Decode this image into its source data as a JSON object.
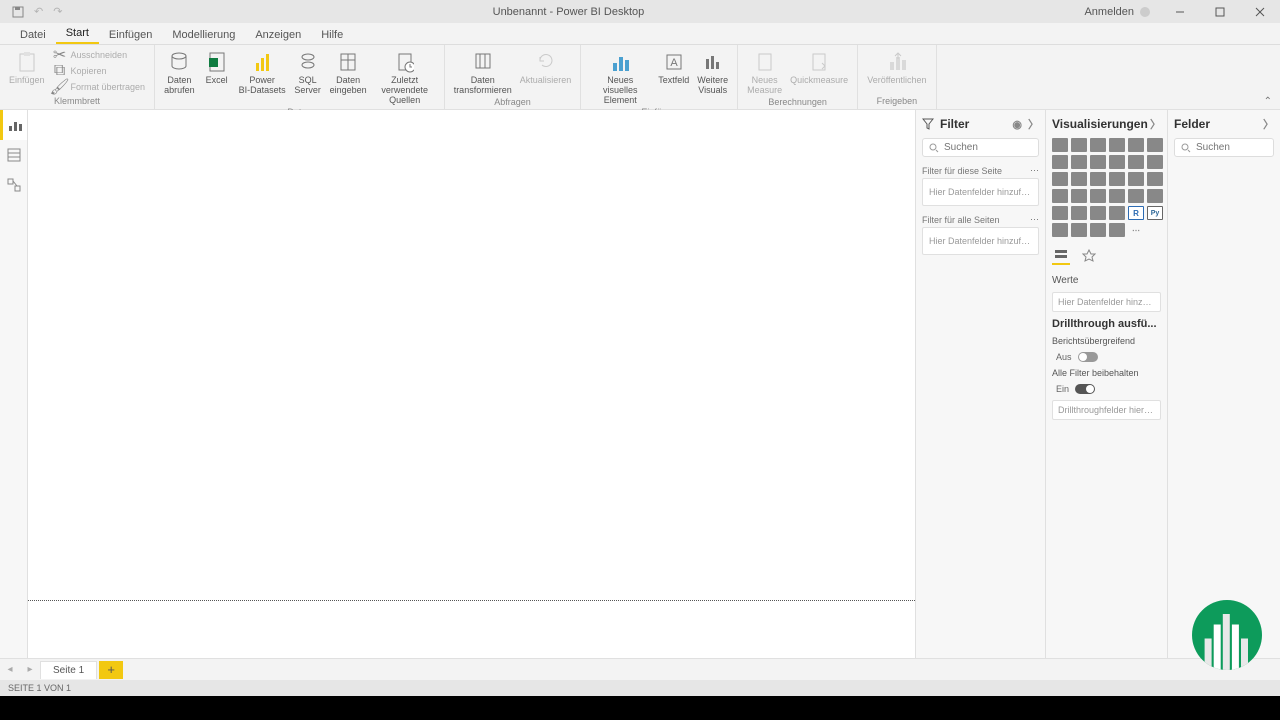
{
  "titlebar": {
    "title": "Unbenannt - Power BI Desktop",
    "signin": "Anmelden"
  },
  "tabs": [
    "Datei",
    "Start",
    "Einfügen",
    "Modellierung",
    "Anzeigen",
    "Hilfe"
  ],
  "ribbon": {
    "groups": {
      "clipboard": {
        "label": "Klemmbrett",
        "paste": "Einfügen",
        "cut": "Ausschneiden",
        "copy": "Kopieren",
        "format": "Format übertragen"
      },
      "data": {
        "label": "Daten",
        "get": "Daten\nabrufen",
        "excel": "Excel",
        "pbi": "Power\nBI-Datasets",
        "sql": "SQL\nServer",
        "enter": "Daten\neingeben",
        "recent": "Zuletzt verwendete\nQuellen"
      },
      "queries": {
        "label": "Abfragen",
        "transform": "Daten\ntransformieren",
        "refresh": "Aktualisieren"
      },
      "insert": {
        "label": "Einfügen",
        "visual": "Neues visuelles\nElement",
        "text": "Textfeld",
        "more": "Weitere\nVisuals"
      },
      "calc": {
        "label": "Berechnungen",
        "measure": "Neues\nMeasure",
        "quick": "Quickmeasure"
      },
      "share": {
        "label": "Freigeben",
        "publish": "Veröffentlichen"
      }
    }
  },
  "filter": {
    "title": "Filter",
    "search_placeholder": "Suchen",
    "page_filters": "Filter für diese Seite",
    "all_filters": "Filter für alle Seiten",
    "add_placeholder": "Hier Datenfelder hinzufüg..."
  },
  "viz": {
    "title": "Visualisierungen",
    "values": "Werte",
    "values_placeholder": "Hier Datenfelder hinzufügen",
    "drillthrough": "Drillthrough ausfü...",
    "cross_report": "Berichtsübergreifend",
    "off": "Aus",
    "keep_filters": "Alle Filter beibehalten",
    "on": "Ein",
    "dt_placeholder": "Drillthroughfelder hier hinz..."
  },
  "fields": {
    "title": "Felder",
    "search_placeholder": "Suchen"
  },
  "pages": {
    "tab1": "Seite 1"
  },
  "status": "SEITE 1 VON 1"
}
